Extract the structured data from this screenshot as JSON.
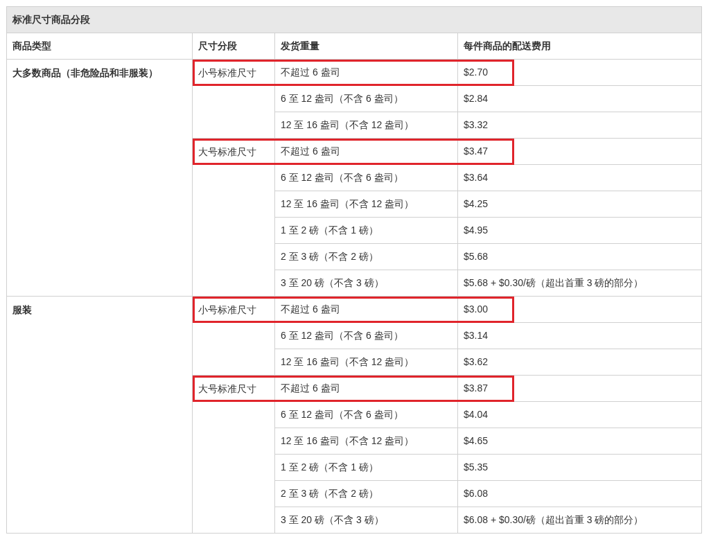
{
  "table": {
    "title": "标准尺寸商品分段",
    "columns": [
      "商品类型",
      "尺寸分段",
      "发货重量",
      "每件商品的配送费用"
    ],
    "groups": [
      {
        "category": "大多数商品（非危险品和非服装）",
        "tiers": [
          {
            "name": "小号标准尺寸",
            "highlighted": true,
            "rows": [
              {
                "weight": "不超过 6 盎司",
                "fee": "$2.70"
              },
              {
                "weight": "6 至 12 盎司（不含 6 盎司）",
                "fee": "$2.84"
              },
              {
                "weight": "12 至 16 盎司（不含 12 盎司）",
                "fee": "$3.32"
              }
            ]
          },
          {
            "name": "大号标准尺寸",
            "highlighted": true,
            "rows": [
              {
                "weight": "不超过 6 盎司",
                "fee": "$3.47"
              },
              {
                "weight": "6 至 12 盎司（不含 6 盎司）",
                "fee": "$3.64"
              },
              {
                "weight": "12 至 16 盎司（不含 12 盎司）",
                "fee": "$4.25"
              },
              {
                "weight": "1 至 2 磅（不含 1 磅）",
                "fee": "$4.95"
              },
              {
                "weight": "2 至 3 磅（不含 2 磅）",
                "fee": "$5.68"
              },
              {
                "weight": "3 至 20 磅（不含 3 磅）",
                "fee": "$5.68 + $0.30/磅（超出首重 3 磅的部分）"
              }
            ]
          }
        ]
      },
      {
        "category": "服装",
        "tiers": [
          {
            "name": "小号标准尺寸",
            "highlighted": true,
            "rows": [
              {
                "weight": "不超过 6 盎司",
                "fee": "$3.00"
              },
              {
                "weight": "6 至 12 盎司（不含 6 盎司）",
                "fee": "$3.14"
              },
              {
                "weight": "12 至 16 盎司（不含 12 盎司）",
                "fee": "$3.62"
              }
            ]
          },
          {
            "name": "大号标准尺寸",
            "highlighted": true,
            "rows": [
              {
                "weight": "不超过 6 盎司",
                "fee": "$3.87"
              },
              {
                "weight": "6 至 12 盎司（不含 6 盎司）",
                "fee": "$4.04"
              },
              {
                "weight": "12 至 16 盎司（不含 12 盎司）",
                "fee": "$4.65"
              },
              {
                "weight": "1 至 2 磅（不含 1 磅）",
                "fee": "$5.35"
              },
              {
                "weight": "2 至 3 磅（不含 2 磅）",
                "fee": "$6.08"
              },
              {
                "weight": "3 至 20 磅（不含 3 磅）",
                "fee": "$6.08 + $0.30/磅（超出首重 3 磅的部分）"
              }
            ]
          }
        ]
      }
    ]
  }
}
